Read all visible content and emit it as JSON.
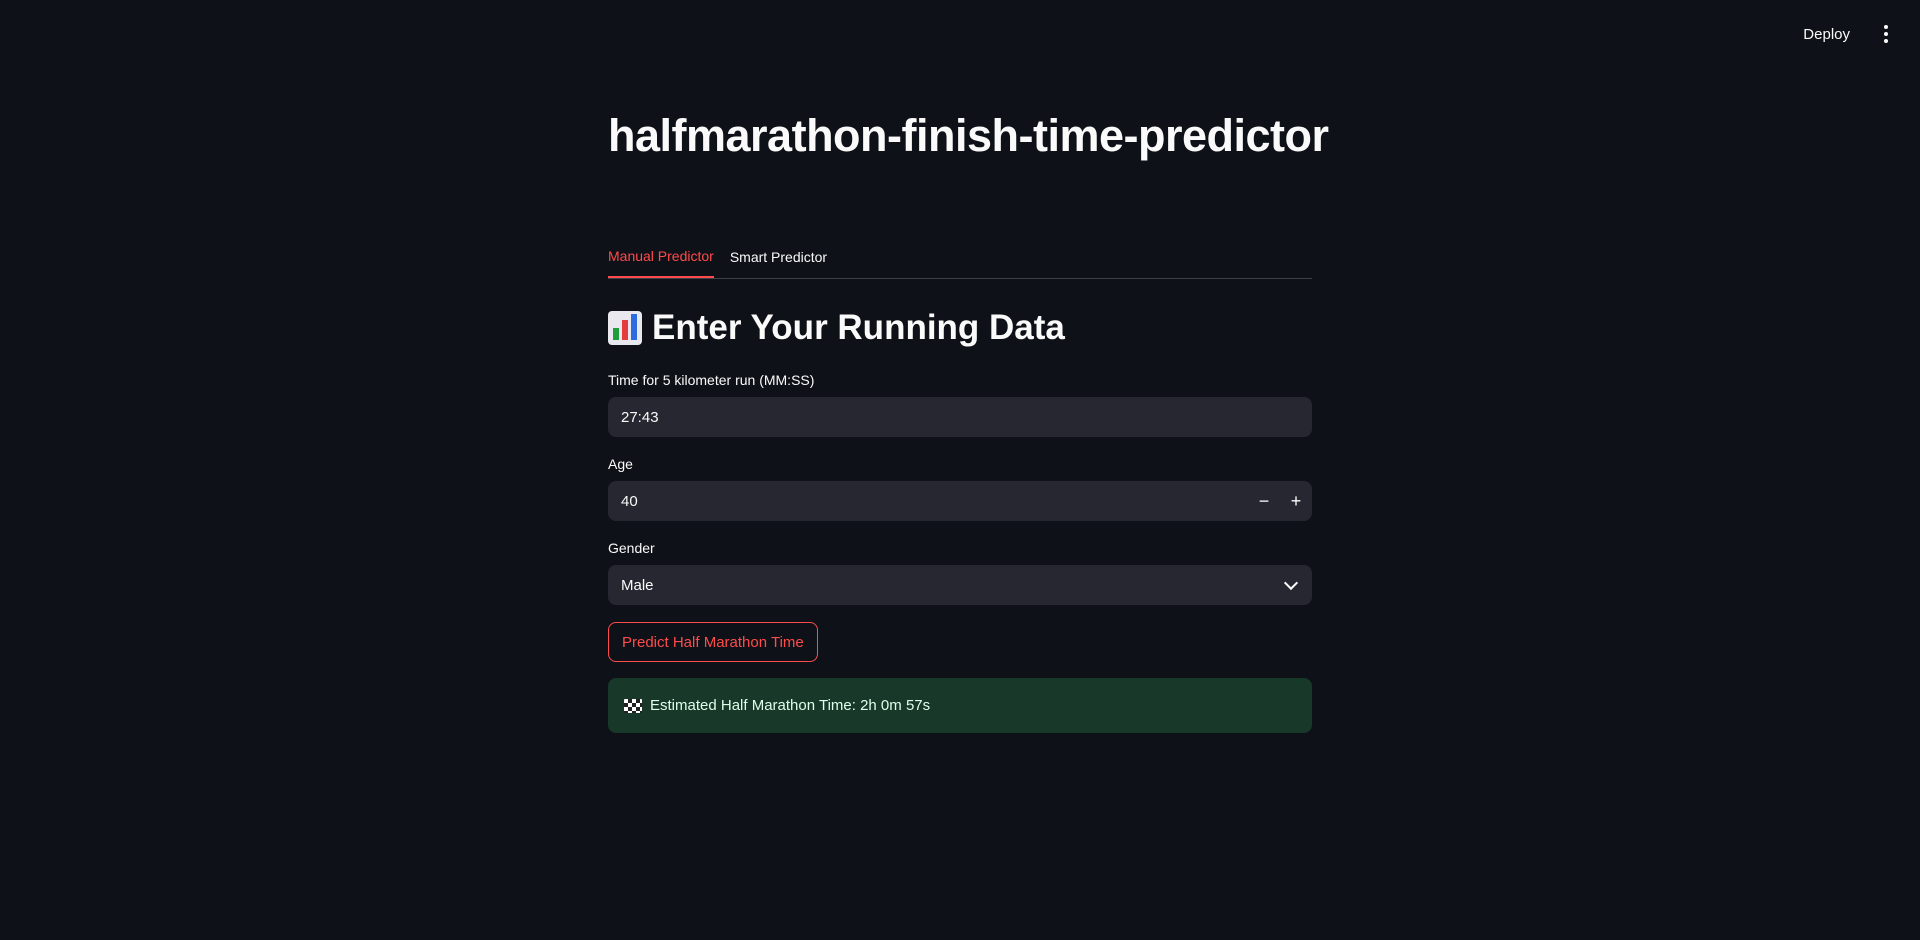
{
  "header": {
    "deploy_label": "Deploy",
    "menu_icon": "kebab-menu-icon"
  },
  "page": {
    "title": "halfmarathon-finish-time-predictor"
  },
  "tabs": [
    {
      "label": "Manual Predictor",
      "active": true
    },
    {
      "label": "Smart Predictor",
      "active": false
    }
  ],
  "section": {
    "icon": "bar-chart-icon",
    "heading": "Enter Your Running Data"
  },
  "form": {
    "time_label": "Time for 5 kilometer run (MM:SS)",
    "time_value": "27:43",
    "age_label": "Age",
    "age_value": "40",
    "decrement_symbol": "−",
    "increment_symbol": "+",
    "gender_label": "Gender",
    "gender_value": "Male",
    "predict_button": "Predict Half Marathon Time"
  },
  "result": {
    "icon": "checkered-flag-icon",
    "text": "Estimated Half Marathon Time: 2h 0m 57s"
  },
  "colors": {
    "background": "#0e1117",
    "accent": "#ff4b4b",
    "input_bg": "#262730",
    "success_bg": "#183829"
  }
}
